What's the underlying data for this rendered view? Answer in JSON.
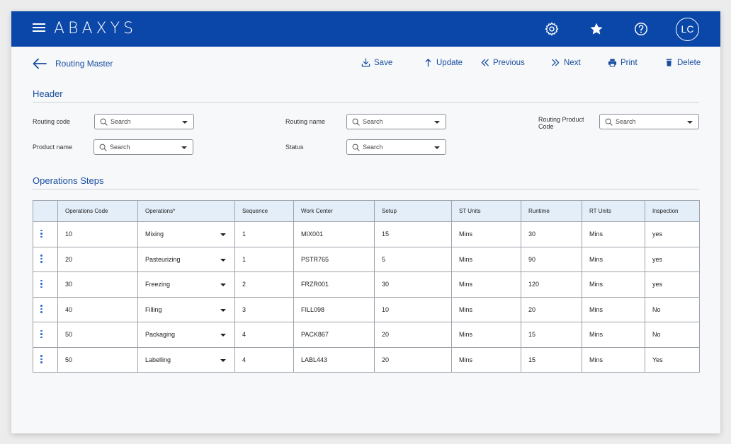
{
  "app": {
    "brand": "ABAXYS",
    "user_initials": "LC"
  },
  "page": {
    "title": "Routing Master"
  },
  "actions": {
    "save": "Save",
    "update": "Update",
    "previous": "Previous",
    "next": "Next",
    "print": "Print",
    "delete": "Delete"
  },
  "header_section": {
    "title": "Header",
    "fields": {
      "routing_code": {
        "label": "Routing code",
        "placeholder": "Search"
      },
      "routing_name": {
        "label": "Routing name",
        "placeholder": "Search"
      },
      "routing_product_code": {
        "label": "Routing Product Code",
        "placeholder": "Search"
      },
      "product_name": {
        "label": "Product name",
        "placeholder": "Search"
      },
      "status": {
        "label": "Status",
        "placeholder": "Search"
      }
    }
  },
  "operations": {
    "title": "Operations Steps",
    "columns": [
      "Operations Code",
      "Operations*",
      "Sequence",
      "Work Center",
      "Setup",
      "ST Units",
      "Runtime",
      "RT Units",
      "Inspection"
    ],
    "rows": [
      [
        "10",
        "Mixing",
        "1",
        "MIX001",
        "15",
        "Mins",
        "30",
        "Mins",
        "yes"
      ],
      [
        "20",
        "Pasteurizing",
        "1",
        "PSTR765",
        "5",
        "Mins",
        "90",
        "Mins",
        "yes"
      ],
      [
        "30",
        "Freezing",
        "2",
        "FRZR001",
        "30",
        "Mins",
        "120",
        "Mins",
        "yes"
      ],
      [
        "40",
        "Filling",
        "3",
        "FILL098",
        "10",
        "Mins",
        "20",
        "Mins",
        "No"
      ],
      [
        "50",
        "Packaging",
        "4",
        "PACK867",
        "20",
        "Mins",
        "15",
        "Mins",
        "No"
      ],
      [
        "50",
        "Labelling",
        "4",
        "LABL443",
        "20",
        "Mins",
        "15",
        "Mins",
        "Yes"
      ]
    ]
  },
  "colors": {
    "brand_blue": "#0a47a8",
    "link_blue": "#1a4ea0",
    "header_row": "#e3eef9"
  }
}
